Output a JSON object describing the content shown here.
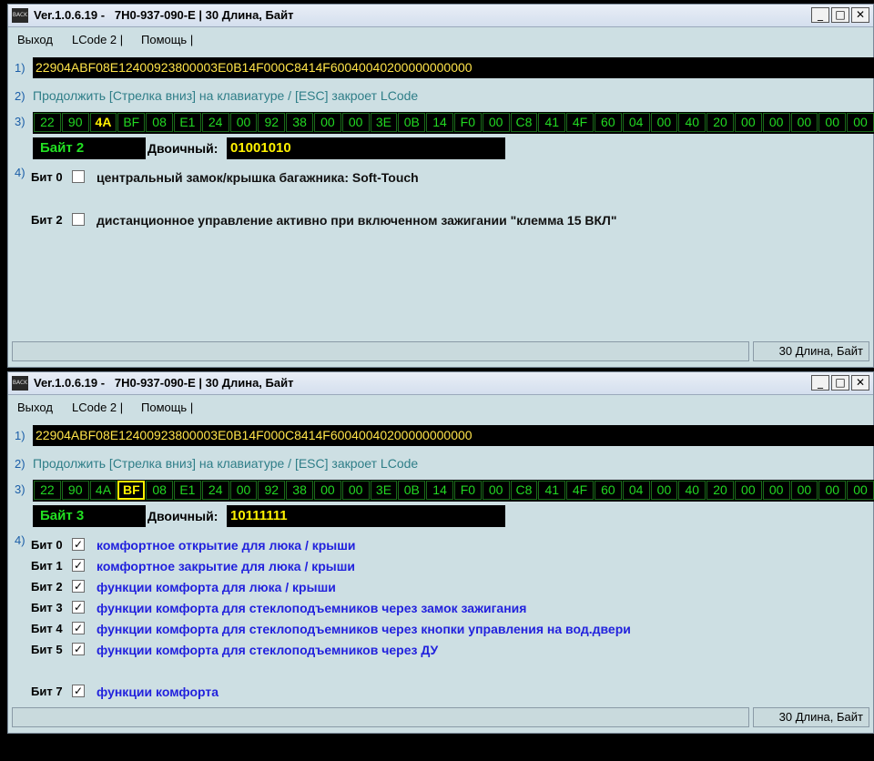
{
  "windows": [
    {
      "title": "Ver.1.0.6.19 -   7H0-937-090-E | 30 Длина, Байт",
      "menu": [
        "Выход",
        "LCode 2 |",
        "Помощь |"
      ],
      "row_numbers": [
        "1)",
        "2)",
        "3)",
        "4)"
      ],
      "hex_string": "22904ABF08E12400923800003E0B14F000C8414F60040040200000000000",
      "hint": "Продолжить [Стрелка вниз] на клавиатуре / [ESC] закроет LCode",
      "bytes": [
        "22",
        "90",
        "4A",
        "BF",
        "08",
        "E1",
        "24",
        "00",
        "92",
        "38",
        "00",
        "00",
        "3E",
        "0B",
        "14",
        "F0",
        "00",
        "C8",
        "41",
        "4F",
        "60",
        "04",
        "00",
        "40",
        "20",
        "00",
        "00",
        "00",
        "00",
        "00"
      ],
      "selected_byte_index": 2,
      "byte_label": "Байт 2",
      "binary_label": "Двоичный:",
      "binary_value": "01001010",
      "bits": [
        {
          "name": "Бит 0",
          "checked": false,
          "text": "центральный замок/крышка багажника: Soft-Touch"
        },
        {
          "name": "Бит 2",
          "checked": false,
          "text": "дистанционное управление активно при включенном зажигании \"клемма 15 ВКЛ\""
        }
      ],
      "status_text": "30 Длина, Байт"
    },
    {
      "title": "Ver.1.0.6.19 -   7H0-937-090-E | 30 Длина, Байт",
      "menu": [
        "Выход",
        "LCode 2 |",
        "Помощь |"
      ],
      "row_numbers": [
        "1)",
        "2)",
        "3)",
        "4)"
      ],
      "hex_string": "22904ABF08E12400923800003E0B14F000C8414F60040040200000000000",
      "hint": "Продолжить [Стрелка вниз] на клавиатуре / [ESC] закроет LCode",
      "bytes": [
        "22",
        "90",
        "4A",
        "BF",
        "08",
        "E1",
        "24",
        "00",
        "92",
        "38",
        "00",
        "00",
        "3E",
        "0B",
        "14",
        "F0",
        "00",
        "C8",
        "41",
        "4F",
        "60",
        "04",
        "00",
        "40",
        "20",
        "00",
        "00",
        "00",
        "00",
        "00"
      ],
      "selected_byte_index": 3,
      "byte_label": "Байт 3",
      "binary_label": "Двоичный:",
      "binary_value": "10111111",
      "bits": [
        {
          "name": "Бит 0",
          "checked": true,
          "text": "комфортное открытие для люка / крыши"
        },
        {
          "name": "Бит 1",
          "checked": true,
          "text": "комфортное закрытие для люка / крыши"
        },
        {
          "name": "Бит 2",
          "checked": true,
          "text": "функции комфорта для люка / крыши"
        },
        {
          "name": "Бит 3",
          "checked": true,
          "text": "функции комфорта для стеклоподъемников через замок зажигания"
        },
        {
          "name": "Бит 4",
          "checked": true,
          "text": "функции комфорта для стеклоподъемников через кнопки управления на вод.двери"
        },
        {
          "name": "Бит 5",
          "checked": true,
          "text": "функции комфорта для стеклоподъемников через ДУ"
        },
        {
          "name": "Бит 7",
          "checked": true,
          "text": "функции комфорта"
        }
      ],
      "status_text": "30 Длина, Байт"
    }
  ],
  "colors": {
    "window_bg": "#cddfe3",
    "hex_text": "#ffe44a",
    "byte_text": "#22d822",
    "hint_text": "#2f7e88",
    "bit_text_checked": "#2222dd"
  },
  "icons": {
    "app": "app-icon",
    "minimize": "minimize-icon",
    "maximize": "maximize-icon",
    "close": "close-icon",
    "check": "✓"
  }
}
